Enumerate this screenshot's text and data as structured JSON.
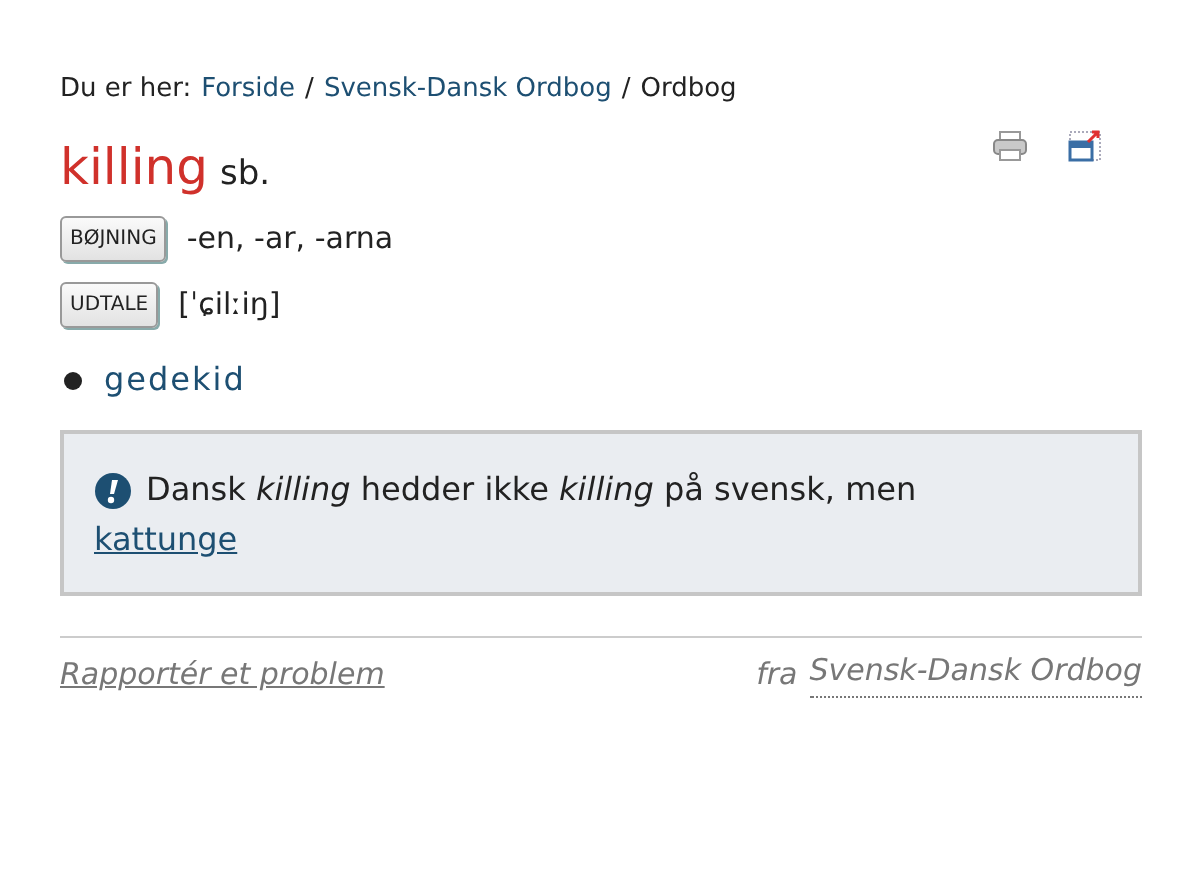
{
  "breadcrumb": {
    "label": "Du er her:",
    "items": [
      {
        "text": "Forside",
        "kind": "link"
      },
      {
        "text": "/",
        "kind": "separator"
      },
      {
        "text": "Svensk-Dansk Ordbog",
        "kind": "link"
      },
      {
        "text": "/",
        "kind": "separator"
      },
      {
        "text": "Ordbog",
        "kind": "current"
      }
    ]
  },
  "entry": {
    "headword": "killing",
    "pos": "sb."
  },
  "rows": [
    {
      "button": "BØJNING",
      "value": "-en, -ar, -arna"
    },
    {
      "button": "UDTALE",
      "value": "[ˈɕilːiŋ]"
    }
  ],
  "translations": [
    "gedekid"
  ],
  "note": {
    "text": "Dansk *killing* hedder ikke *killing* på svensk, men",
    "link": "kattunge"
  },
  "footer": {
    "report": "Rapportér et problem",
    "source_prefix": "fra",
    "source": "Svensk-Dansk Ordbog"
  }
}
